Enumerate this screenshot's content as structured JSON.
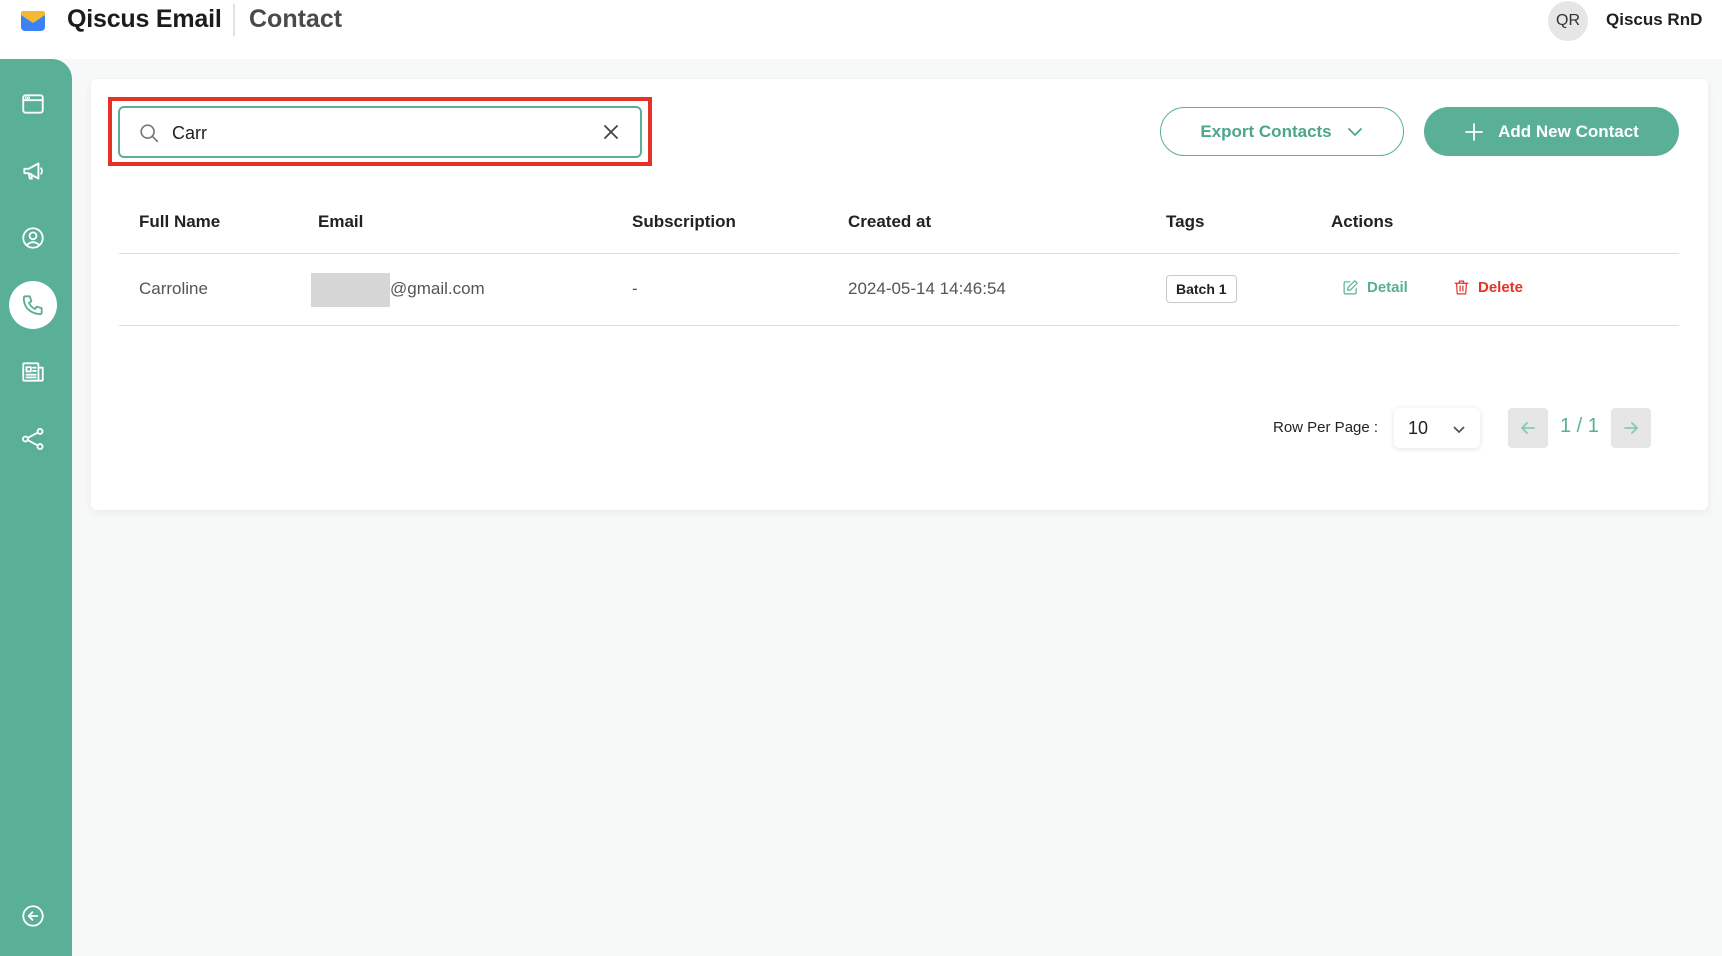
{
  "header": {
    "brand": "Qiscus Email",
    "page_title": "Contact",
    "avatar_initials": "QR",
    "user_name": "Qiscus RnD"
  },
  "sidebar": {
    "items": [
      {
        "icon": "browser-window-icon",
        "active": false
      },
      {
        "icon": "megaphone-icon",
        "active": false
      },
      {
        "icon": "user-circle-icon",
        "active": false
      },
      {
        "icon": "phone-icon",
        "active": true
      },
      {
        "icon": "newspaper-icon",
        "active": false
      },
      {
        "icon": "share-nodes-icon",
        "active": false
      }
    ],
    "collapse_icon": "arrow-left-circle-icon"
  },
  "search": {
    "value": "Carr"
  },
  "toolbar": {
    "export_label": "Export Contacts",
    "add_label": "Add New Contact"
  },
  "table": {
    "columns": [
      "Full Name",
      "Email",
      "Subscription",
      "Created at",
      "Tags",
      "Actions"
    ],
    "rows": [
      {
        "full_name": "Carroline",
        "email": "@gmail.com",
        "subscription": "-",
        "created_at": "2024-05-14 14:46:54",
        "tag": "Batch 1",
        "detail_label": "Detail",
        "delete_label": "Delete"
      }
    ]
  },
  "pagination": {
    "rows_label": "Row Per Page :",
    "rows_per_page": "10",
    "page_info": "1 / 1"
  },
  "colors": {
    "accent": "#5aaf97",
    "danger": "#e53226",
    "highlight": "#e53226"
  }
}
